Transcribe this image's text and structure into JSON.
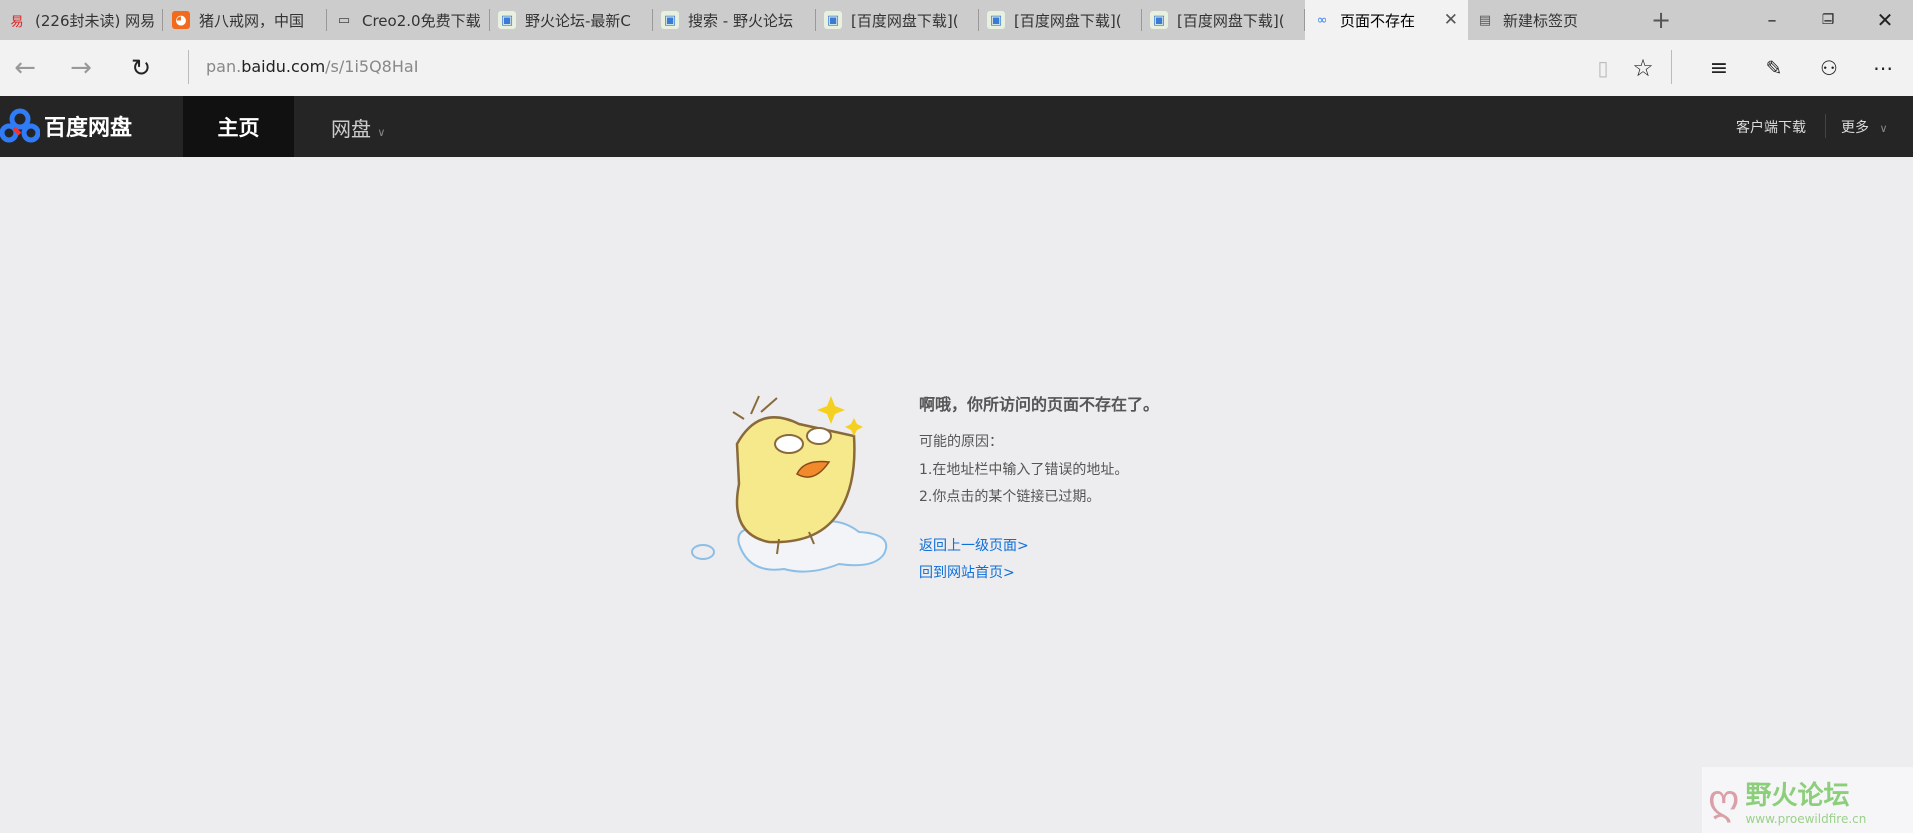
{
  "tabs": [
    {
      "label": "(226封未读) 网易",
      "icon": "netease-mail-icon"
    },
    {
      "label": "猪八戒网，中国",
      "icon": "zbj-icon"
    },
    {
      "label": "Creo2.0免费下载",
      "icon": "page-icon"
    },
    {
      "label": "野火论坛-最新C",
      "icon": "forum-icon"
    },
    {
      "label": "搜索 - 野火论坛",
      "icon": "forum-icon"
    },
    {
      "label": "[百度网盘下载](",
      "icon": "forum-icon"
    },
    {
      "label": "[百度网盘下载](",
      "icon": "forum-icon"
    },
    {
      "label": "[百度网盘下载](",
      "icon": "forum-icon"
    },
    {
      "label": "页面不存在",
      "icon": "baidu-pan-icon",
      "active": true
    },
    {
      "label": "新建标签页",
      "icon": "new-tab-page-icon"
    }
  ],
  "address": {
    "prefix": "pan.",
    "domain": "baidu.com",
    "path": "/s/1i5Q8HaI"
  },
  "nav": {
    "logo": "百度网盘",
    "home": "主页",
    "pan": "网盘",
    "client_download": "客户端下载",
    "more": "更多"
  },
  "error": {
    "title": "啊哦，你所访问的页面不存在了。",
    "reasons_label": "可能的原因：",
    "reason1": "1.在地址栏中输入了错误的地址。",
    "reason2": "2.你点击的某个链接已过期。",
    "back_link": "返回上一级页面>",
    "home_link": "回到网站首页>"
  },
  "watermark": {
    "name": "野火论坛",
    "url": "www.proewildfire.cn"
  }
}
